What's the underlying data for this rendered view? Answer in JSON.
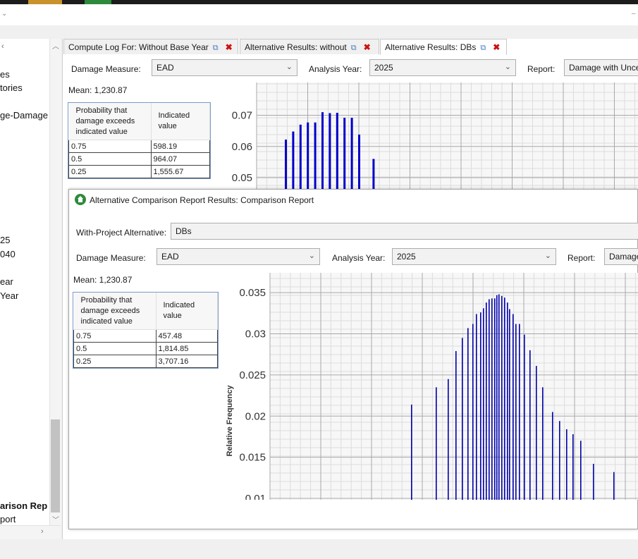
{
  "sidebar": {
    "items": [
      "es",
      "tories",
      "ge-Damage",
      "25",
      "040",
      "ear",
      " Year",
      "arison Rep",
      "port"
    ]
  },
  "tabs": [
    {
      "label": "Compute Log For: Without Base Year"
    },
    {
      "label": "Alternative Results: without"
    },
    {
      "label": "Alternative Results: DBs"
    }
  ],
  "results": {
    "damage_measure_label": "Damage Measure:",
    "damage_measure_value": "EAD",
    "analysis_year_label": "Analysis Year:",
    "analysis_year_value": "2025",
    "report_label": "Report:",
    "report_value": "Damage with Uncertainty",
    "mean_text": "Mean:  1,230.87",
    "table": {
      "header_prob": "Probability that damage exceeds indicated value",
      "header_val": "Indicated value",
      "rows": [
        [
          "0.75",
          "598.19"
        ],
        [
          "0.5",
          "964.07"
        ],
        [
          "0.25",
          "1,555.67"
        ]
      ]
    }
  },
  "comparison": {
    "title": "Alternative Comparison Report Results: Comparison Report",
    "with_project_label": "With-Project Alternative:",
    "with_project_value": "DBs",
    "damage_measure_label": "Damage Measure:",
    "damage_measure_value": "EAD",
    "analysis_year_label": "Analysis Year:",
    "analysis_year_value": "2025",
    "report_label": "Report:",
    "report_value": "Damage",
    "mean_text": "Mean:  1,230.87",
    "table": {
      "header_prob": "Probability that damage exceeds indicated value",
      "header_val": "Indicated value",
      "rows": [
        [
          "0.75",
          "457.48"
        ],
        [
          "0.5",
          "1,814.85"
        ],
        [
          "0.25",
          "3,707.16"
        ]
      ]
    }
  },
  "chart_data": [
    {
      "type": "bar",
      "title": "",
      "xlabel": "",
      "ylabel": "",
      "y_ticks": [
        "0.07",
        "0.06",
        "0.05"
      ],
      "ylim": [
        0.0475,
        0.0742
      ],
      "grid": true,
      "color": "#0000cc",
      "values": [
        0.0622,
        0.0648,
        0.067,
        0.0677,
        0.0677,
        0.071,
        0.0707,
        0.0708,
        0.0692,
        0.0692,
        0.0638,
        0.056
      ]
    },
    {
      "type": "bar",
      "title": "",
      "xlabel": "",
      "ylabel": "Relative Frequency",
      "y_ticks": [
        "0.035",
        "0.03",
        "0.025",
        "0.02",
        "0.015",
        "0.01"
      ],
      "ylim": [
        0.01,
        0.0357
      ],
      "grid": true,
      "color": "#0000aa",
      "values": [
        0.0214,
        0.0235,
        0.0245,
        0.0279,
        0.0295,
        0.0307,
        0.0312,
        0.0324,
        0.0326,
        0.0331,
        0.0338,
        0.0342,
        0.0343,
        0.0343,
        0.0347,
        0.0348,
        0.0346,
        0.0344,
        0.0338,
        0.033,
        0.0324,
        0.0312,
        0.0312,
        0.0299,
        0.028,
        0.0261,
        0.0235,
        0.0205,
        0.0194,
        0.0184,
        0.0178,
        0.017,
        0.0142,
        0.0132
      ]
    }
  ]
}
